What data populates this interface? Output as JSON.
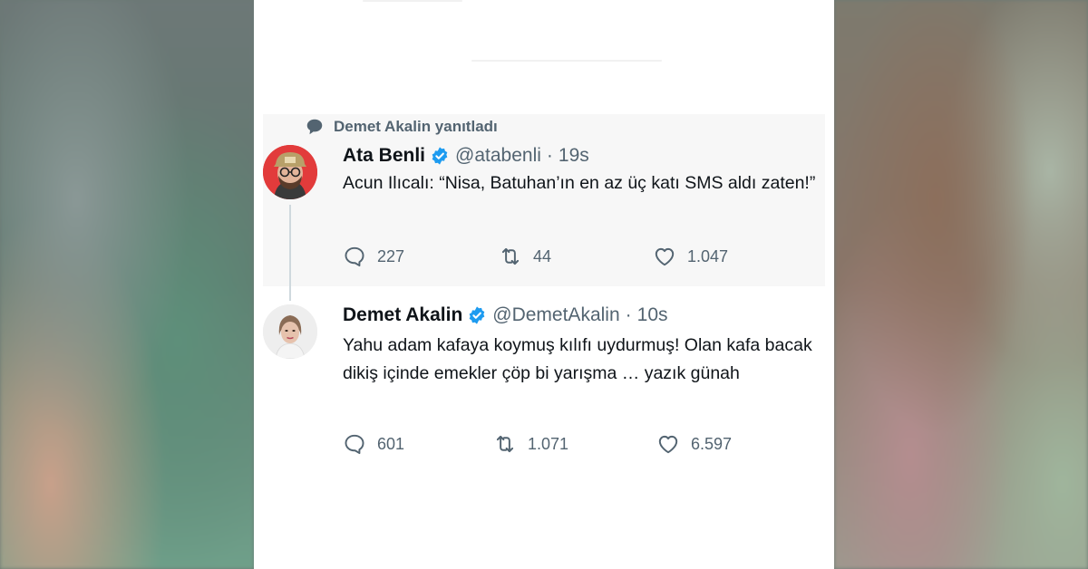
{
  "reply_context": "Demet Akalin yanıtladı",
  "tweets": [
    {
      "name": "Ata Benli",
      "handle": "@atabenli",
      "separator": "·",
      "time": "19s",
      "text": "Acun Ilıcalı: “Nisa, Batuhan’ın en az üç katı SMS aldı zaten!”",
      "replies": "227",
      "retweets": "44",
      "likes": "1.047"
    },
    {
      "name": "Demet Akalin",
      "handle": "@DemetAkalin",
      "separator": "·",
      "time": "10s",
      "text": "Yahu adam kafaya koymuş kılıfı uydurmuş! Olan kafa bacak dikiş içinde emekler çöp bi yarışma … yazık günah",
      "replies": "601",
      "retweets": "1.071",
      "likes": "6.597"
    }
  ],
  "colors": {
    "verified": "#1d9bf0",
    "muted": "#536471",
    "text": "#0f1419",
    "highlight_bg": "#f7f7f7"
  },
  "icons": [
    "speech-bubble-icon",
    "verified-badge-icon",
    "reply-icon",
    "retweet-icon",
    "like-icon"
  ]
}
